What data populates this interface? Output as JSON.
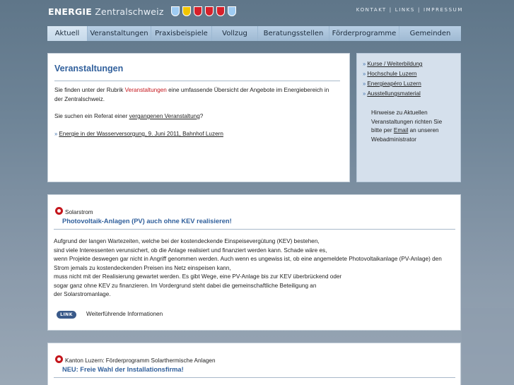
{
  "header": {
    "logo_bold": "ENERGIE",
    "logo_rest": " Zentralschweiz",
    "crests": [
      {
        "name": "crest-luzern",
        "color": "#9ecbf2"
      },
      {
        "name": "crest-uri",
        "color": "#f2c500"
      },
      {
        "name": "crest-schwyz",
        "color": "#d6202a"
      },
      {
        "name": "crest-obwalden",
        "color": "#d6202a"
      },
      {
        "name": "crest-nidwalden",
        "color": "#d6202a"
      },
      {
        "name": "crest-zug",
        "color": "#9ecbf2"
      }
    ],
    "topnav": [
      "KONTAKT",
      "LINKS",
      "IMPRESSUM"
    ]
  },
  "mainnav": [
    {
      "label": "Aktuell",
      "active": true
    },
    {
      "label": "Veranstaltungen",
      "active": false
    },
    {
      "label": "Praxisbeispiele",
      "active": false
    },
    {
      "label": "Vollzug",
      "active": false
    },
    {
      "label": "Beratungsstellen",
      "active": false
    },
    {
      "label": "Förderprogramme",
      "active": false
    },
    {
      "label": "Gemeinden",
      "active": false
    }
  ],
  "main": {
    "title": "Veranstaltungen",
    "p1_pre": "Sie finden unter der Rubrik ",
    "p1_link": "Veranstaltungen",
    "p1_post": " eine umfassende Übersicht der Angebote im Energiebereich in",
    "p1_line2": "der Zentralschweiz.",
    "p2_pre": "Sie suchen ein Referat einer ",
    "p2_link": "vergangenen Veranstaltung",
    "p2_post": "?",
    "event_link": "Energie in der Wasserversorgung, 9. Juni 2011, Bahnhof Luzern"
  },
  "sidebar": {
    "links": [
      "Kurse / Weiterbildung",
      "Hochschule Luzern",
      "Energieapéro Luzern",
      "Ausstellungsmaterial"
    ],
    "note_line1": "Hinweise zu Aktuellen",
    "note_line2": "Veranstaltungen richten Sie",
    "note_line3_pre": "bitte per ",
    "note_line3_link": "Email",
    "note_line3_post": " an unseren",
    "note_line4": "Webadministrator"
  },
  "news1": {
    "category": "Solarstrom",
    "title": "Photovoltaik-Anlagen (PV) auch ohne KEV realisieren!",
    "lines": [
      "Aufgrund der langen Wartezeiten, welche bei der kostendeckende Einspeisevergütung (KEV) bestehen,",
      "sind viele Interessenten verunsichert, ob die Anlage realisiert und finanziert werden kann. Schade wäre es,",
      "wenn Projekte deswegen gar nicht in Angriff genommen werden. Auch wenn es ungewiss ist, ob eine angemeldete Photovoltaikanlage (PV-Anlage) den",
      "Strom jemals zu kostendeckenden Preisen ins Netz einspeisen kann,",
      "muss nicht mit der Realisierung gewartet werden. Es gibt Wege, eine PV-Anlage bis zur KEV überbrückend oder",
      "sogar ganz ohne KEV zu finanzieren. Im Vordergrund steht dabei die gemeinschaftliche Beteiligung an",
      "der Solarstromanlage."
    ],
    "link_badge": "LINK",
    "link_text": "Weiterführende Informationen"
  },
  "news2": {
    "category": "Kanton Luzern: Förderprogramm Solarthermische Anlagen",
    "title": "NEU: Freie Wahl der Installationsfirma!"
  }
}
